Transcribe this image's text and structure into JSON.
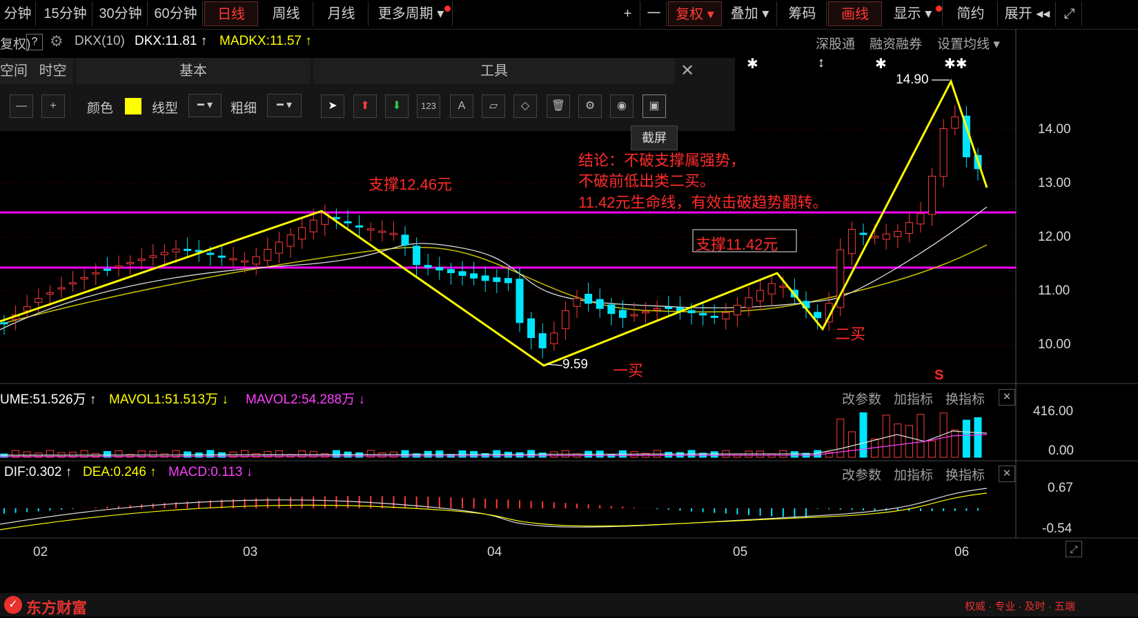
{
  "toolbar": {
    "periods": [
      "分钟",
      "15分钟",
      "30分钟",
      "60分钟",
      "日线",
      "周线",
      "月线",
      "更多周期"
    ],
    "right": [
      "+",
      "一",
      "复权",
      "叠加",
      "筹码",
      "画线",
      "显示",
      "简约",
      "展开",
      "⤢"
    ]
  },
  "indicator_line": {
    "prefix": "复权)",
    "help": "?",
    "name": "DKX(10)",
    "dkx": "DKX:11.81",
    "madkx": "MADKX:11.57",
    "links": [
      "深股通",
      "融资融券",
      "设置均线"
    ]
  },
  "draw_panel": {
    "tabs": [
      "空间",
      "时空"
    ],
    "head_basic": "基本",
    "head_tools": "工具",
    "color_label": "颜色",
    "line_label": "线型",
    "width_label": "粗细",
    "tools": [
      "arrow",
      "up-arrow",
      "down-arrow",
      "123",
      "A",
      "ruler",
      "eraser",
      "trash",
      "gear",
      "eye",
      "screenshot"
    ],
    "tooltip": "截屏"
  },
  "annotations": {
    "support1": "支撑12.46元",
    "support2": "支撑11.42元",
    "conclusion1": "结论：不破支撑属强势，",
    "conclusion2": "不破前低出类二买。",
    "conclusion3": "11.42元生命线，有效击破趋势翻转。",
    "buy1": "一买",
    "buy2": "二买",
    "high_label": "14.90",
    "low_label": "9.59",
    "s_mark": "S"
  },
  "price_axis": [
    "14.00",
    "13.00",
    "12.00",
    "11.00",
    "10.00"
  ],
  "volume": {
    "vol": "UME:51.526万",
    "mavol1": "MAVOL1:51.513万",
    "mavol2": "MAVOL2:54.288万",
    "axis": [
      "416.00",
      "0.00"
    ],
    "actions": [
      "改参数",
      "加指标",
      "换指标"
    ]
  },
  "macd": {
    "dif": "DIF:0.302",
    "dea": "DEA:0.246",
    "macd": "MACD:0.113",
    "axis": [
      "0.67",
      "-0.54"
    ],
    "actions": [
      "改参数",
      "加指标",
      "换指标"
    ]
  },
  "x_axis": [
    "02",
    "03",
    "04",
    "05",
    "06"
  ],
  "footer": {
    "logo": "东方财富",
    "slogan": "权威 · 专业 · 及时 · 五端"
  },
  "colors": {
    "up": "#ff3b3b",
    "down": "#00e5ff",
    "ma_yellow": "#ffff00",
    "support_line": "#ff00ff",
    "accent_red": "#ff2b2b"
  }
}
